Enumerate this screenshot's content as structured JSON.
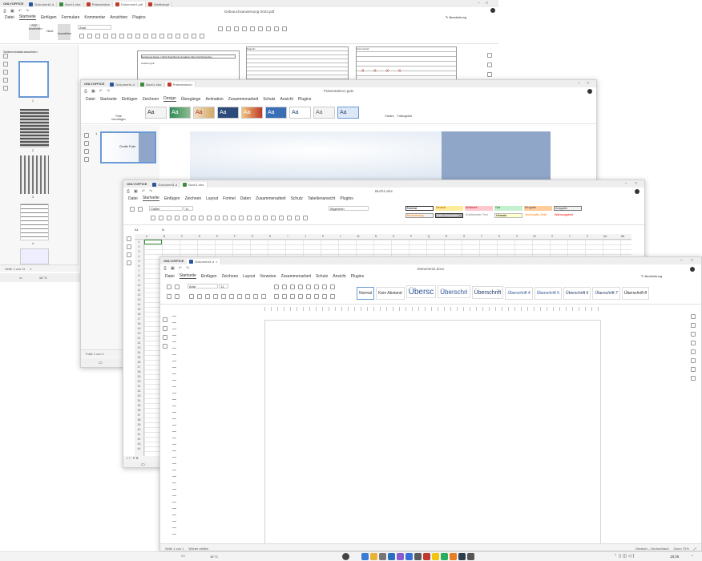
{
  "pdf": {
    "brand": "ONLYOFFICE",
    "tabs": [
      "Dokument1.d",
      "Buch1.xlsx",
      "Präsentation",
      "Dokument1.pdf",
      "Wettkampf"
    ],
    "title": "Gebrauchsanweisung-2023.pdf",
    "menu": [
      "Datei",
      "Startseite",
      "Einfügen",
      "Formulare",
      "Kommentar",
      "Ansichten",
      "Plugins"
    ],
    "mode": "Bearbeitung",
    "font": "Arial",
    "tools": [
      "PDF bearbeiten",
      "Hand",
      "Auswählen"
    ],
    "panel_title": "Seitenminiaturansichten",
    "thumb_numbers": [
      "1",
      "2",
      "3",
      "4"
    ],
    "status_page": "Seite 1 von 11",
    "zoom_indicator": "1",
    "form_labels": [
      "Gefriergut Daten / Nicht Zutreffende Angaben bitte Durchstreichen",
      "Lieferung Nr.",
      "Teile-Nr.",
      "Kommentar",
      "Teile Nr.",
      "Menge",
      "Datum"
    ],
    "form_marks": [
      "X",
      "X",
      "X",
      "X"
    ]
  },
  "presentation": {
    "brand": "ONLYOFFICE",
    "tabs": [
      "Dokument1.d",
      "Buch1.xlsx",
      "Präsentation1"
    ],
    "title": "Präsentation1.pptx",
    "menu": [
      "Datei",
      "Startseite",
      "Einfügen",
      "Zeichnen",
      "Design",
      "Übergänge",
      "Animation",
      "Zusammenarbeit",
      "Schutz",
      "Ansicht",
      "Plugins"
    ],
    "active_menu": "Design",
    "theme_label": "Aa",
    "ribbon_labels": [
      "Folie hinzufügen",
      "Farben",
      "Foliengröße"
    ],
    "slide_thumb_text": "Grafik Folie",
    "slide_number": "1",
    "status_slide": "Folie 1 von 1"
  },
  "spreadsheet": {
    "brand": "ONLYOFFICE",
    "tabs": [
      "Dokument1.d",
      "Buch1.xlsx"
    ],
    "title": "Buch1.xlsx",
    "menu": [
      "Datei",
      "Startseite",
      "Einfügen",
      "Zeichnen",
      "Layout",
      "Formel",
      "Daten",
      "Zusammenarbeit",
      "Schutz",
      "Tabellenansicht",
      "Plugins"
    ],
    "font": "Calibri",
    "font_size": "11",
    "number_format": "Allgemein",
    "cell_styles": [
      {
        "label": "Normal",
        "bg": "#ffffff",
        "fg": "#000000"
      },
      {
        "label": "Neutral",
        "bg": "#ffeb9c",
        "fg": "#9c6500"
      },
      {
        "label": "Schlecht",
        "bg": "#ffc7ce",
        "fg": "#9c0006"
      },
      {
        "label": "Gut",
        "bg": "#c6efce",
        "fg": "#006100"
      },
      {
        "label": "Eingabe",
        "bg": "#ffcc99",
        "fg": "#3f3f76"
      },
      {
        "label": "Ausgabe",
        "bg": "#f2f2f2",
        "fg": "#3f3f3f"
      },
      {
        "label": "Berechnung",
        "bg": "#f2f2f2",
        "fg": "#fa7d00"
      },
      {
        "label": "Zelle überprüfen",
        "bg": "#a5a5a5",
        "fg": "#ffffff"
      },
      {
        "label": "Erklärender Text",
        "bg": "#ffffff",
        "fg": "#7f7f7f"
      },
      {
        "label": "Hinweis",
        "bg": "#ffffcc",
        "fg": "#000000"
      },
      {
        "label": "Verknüpfte Zelle",
        "bg": "#ffffff",
        "fg": "#fa7d00"
      },
      {
        "label": "Warnungstext",
        "bg": "#ffffff",
        "fg": "#ff0000"
      }
    ],
    "name_box": "A1",
    "fx": "fx",
    "columns": [
      "A",
      "B",
      "C",
      "D",
      "E",
      "F",
      "G",
      "H",
      "I",
      "J",
      "K",
      "L",
      "M",
      "N",
      "O",
      "P",
      "Q",
      "R",
      "S",
      "T",
      "U",
      "V",
      "W",
      "X",
      "Y",
      "Z",
      "AA",
      "AB"
    ],
    "rows": [
      "1",
      "2",
      "3",
      "4",
      "5",
      "6",
      "7",
      "8",
      "9",
      "10",
      "11",
      "12",
      "13",
      "14",
      "15",
      "16",
      "17",
      "18",
      "19",
      "20",
      "21",
      "22",
      "23",
      "24",
      "25",
      "26",
      "27",
      "28",
      "29",
      "30",
      "31",
      "32",
      "33",
      "34",
      "35",
      "36",
      "37",
      "38",
      "39",
      "40",
      "41",
      "42",
      "43",
      "44"
    ]
  },
  "document": {
    "brand": "ONLYOFFICE",
    "tabs": [
      "Dokument1.d"
    ],
    "title": "Dokument1.docx",
    "menu": [
      "Datei",
      "Startseite",
      "Einfügen",
      "Zeichnen",
      "Layout",
      "Verweise",
      "Zusammenarbeit",
      "Schutz",
      "Ansicht",
      "Plugins"
    ],
    "mode": "Bearbeitung",
    "font": "Arial",
    "font_size": "11",
    "styles": [
      {
        "label": "Normal",
        "size": "5px",
        "color": "#333333",
        "weight": "normal",
        "italic": false
      },
      {
        "label": "Kein Abstand",
        "size": "5px",
        "color": "#333333",
        "weight": "normal",
        "italic": false
      },
      {
        "label": "Übersc",
        "size": "10px",
        "color": "#2f5496",
        "weight": "normal",
        "italic": false
      },
      {
        "label": "Überschri",
        "size": "8px",
        "color": "#2f5496",
        "weight": "normal",
        "italic": false
      },
      {
        "label": "Überschrift",
        "size": "7px",
        "color": "#1f3763",
        "weight": "normal",
        "italic": false
      },
      {
        "label": "Überschrift 4",
        "size": "5px",
        "color": "#2f5496",
        "weight": "normal",
        "italic": true
      },
      {
        "label": "Überschrift 5",
        "size": "5px",
        "color": "#2f5496",
        "weight": "normal",
        "italic": false
      },
      {
        "label": "Überschrift 6",
        "size": "5px",
        "color": "#1f3763",
        "weight": "normal",
        "italic": false
      },
      {
        "label": "Überschrift 7",
        "size": "5px",
        "color": "#1f3763",
        "weight": "normal",
        "italic": true
      },
      {
        "label": "Überschrift 8",
        "size": "5px",
        "color": "#272727",
        "weight": "normal",
        "italic": true
      }
    ],
    "status_page": "Seite 1 von 1",
    "status_words": "Wörter zählen",
    "status_lang": "Deutsch – Deutschland",
    "status_zoom": "Zoom 70%"
  },
  "taskbar": {
    "weather": "15 °C",
    "time": "18:25",
    "apps": [
      {
        "name": "start",
        "color": "#444444"
      },
      {
        "name": "widgets",
        "color": "#3a7bd5"
      },
      {
        "name": "explorer",
        "color": "#e8b339"
      },
      {
        "name": "search",
        "color": "#777777"
      },
      {
        "name": "folder",
        "color": "#2a6fbd"
      },
      {
        "name": "store",
        "color": "#8a5cd0"
      },
      {
        "name": "mail",
        "color": "#3a6fd8"
      },
      {
        "name": "settings",
        "color": "#5b5b5b"
      },
      {
        "name": "onlyoffice",
        "color": "#c0392b"
      },
      {
        "name": "notes",
        "color": "#f1c40f"
      },
      {
        "name": "chrome",
        "color": "#27ae60"
      },
      {
        "name": "app",
        "color": "#e67e22"
      },
      {
        "name": "app2",
        "color": "#2c3e50"
      },
      {
        "name": "app3",
        "color": "#555555"
      }
    ]
  },
  "colors": {
    "pdf_accent": "#c0392b",
    "pptx_accent": "#c0392b",
    "xlsx_accent": "#3d8b3d",
    "docx_accent": "#2b579a"
  }
}
